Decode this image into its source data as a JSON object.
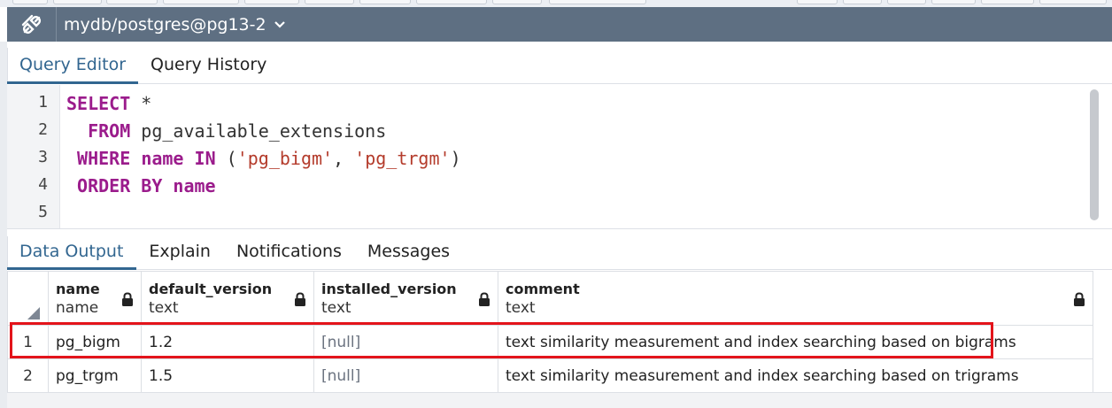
{
  "connection": {
    "label": "mydb/postgres@pg13-2"
  },
  "editor_tabs": [
    {
      "label": "Query Editor",
      "active": true
    },
    {
      "label": "Query History",
      "active": false
    }
  ],
  "editor": {
    "line_numbers": [
      "1",
      "2",
      "3",
      "4",
      "5"
    ],
    "lines": [
      [
        {
          "t": "kw",
          "v": "SELECT"
        },
        {
          "t": "plain",
          "v": " *"
        }
      ],
      [
        {
          "t": "plain",
          "v": "  "
        },
        {
          "t": "kw",
          "v": "FROM"
        },
        {
          "t": "plain",
          "v": " pg_available_extensions"
        }
      ],
      [
        {
          "t": "plain",
          "v": " "
        },
        {
          "t": "kw",
          "v": "WHERE"
        },
        {
          "t": "plain",
          "v": " "
        },
        {
          "t": "kw",
          "v": "name"
        },
        {
          "t": "plain",
          "v": " "
        },
        {
          "t": "kw",
          "v": "IN"
        },
        {
          "t": "plain",
          "v": " ("
        },
        {
          "t": "str",
          "v": "'pg_bigm'"
        },
        {
          "t": "plain",
          "v": ", "
        },
        {
          "t": "str",
          "v": "'pg_trgm'"
        },
        {
          "t": "plain",
          "v": ")"
        }
      ],
      [
        {
          "t": "plain",
          "v": " "
        },
        {
          "t": "kw",
          "v": "ORDER BY"
        },
        {
          "t": "plain",
          "v": " "
        },
        {
          "t": "kw",
          "v": "name"
        }
      ],
      []
    ]
  },
  "output_tabs": [
    {
      "label": "Data Output",
      "active": true
    },
    {
      "label": "Explain",
      "active": false
    },
    {
      "label": "Notifications",
      "active": false
    },
    {
      "label": "Messages",
      "active": false
    }
  ],
  "grid": {
    "columns": [
      {
        "name": "name",
        "type": "name"
      },
      {
        "name": "default_version",
        "type": "text"
      },
      {
        "name": "installed_version",
        "type": "text"
      },
      {
        "name": "comment",
        "type": "text"
      }
    ],
    "rows": [
      {
        "num": "1",
        "name": "pg_bigm",
        "default_version": "1.2",
        "installed_version": "[null]",
        "comment": "text similarity measurement and index searching based on bigrams"
      },
      {
        "num": "2",
        "name": "pg_trgm",
        "default_version": "1.5",
        "installed_version": "[null]",
        "comment": "text similarity measurement and index searching based on trigrams"
      }
    ],
    "highlighted_row": "1"
  },
  "colors": {
    "accent": "#326690",
    "keyword": "#9b1c8c",
    "string": "#b43b2b",
    "connection_bar": "#5e6f82",
    "highlight": "#e3141b"
  }
}
